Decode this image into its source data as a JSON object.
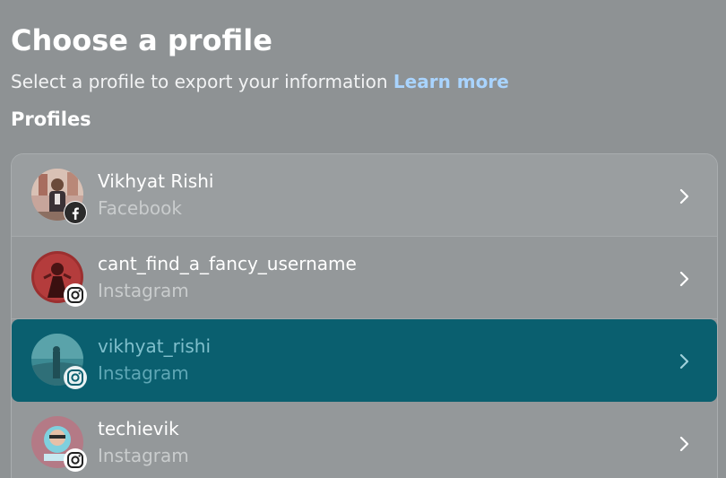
{
  "header": {
    "title": "Choose a profile",
    "subtitle": "Select a profile to export your information",
    "learn_more": "Learn more",
    "section_title": "Profiles"
  },
  "profiles": [
    {
      "name": "Vikhyat Rishi",
      "platform": "Facebook",
      "badge_icon": "facebook-icon",
      "selected": false
    },
    {
      "name": "cant_find_a_fancy_username",
      "platform": "Instagram",
      "badge_icon": "instagram-icon",
      "selected": false
    },
    {
      "name": "vikhyat_rishi",
      "platform": "Instagram",
      "badge_icon": "instagram-icon",
      "selected": true
    },
    {
      "name": "techievik",
      "platform": "Instagram",
      "badge_icon": "instagram-icon",
      "selected": false
    }
  ],
  "colors": {
    "background": "#8e9294",
    "link": "#a9d4ff",
    "selected_row": "#0a5f6f"
  }
}
